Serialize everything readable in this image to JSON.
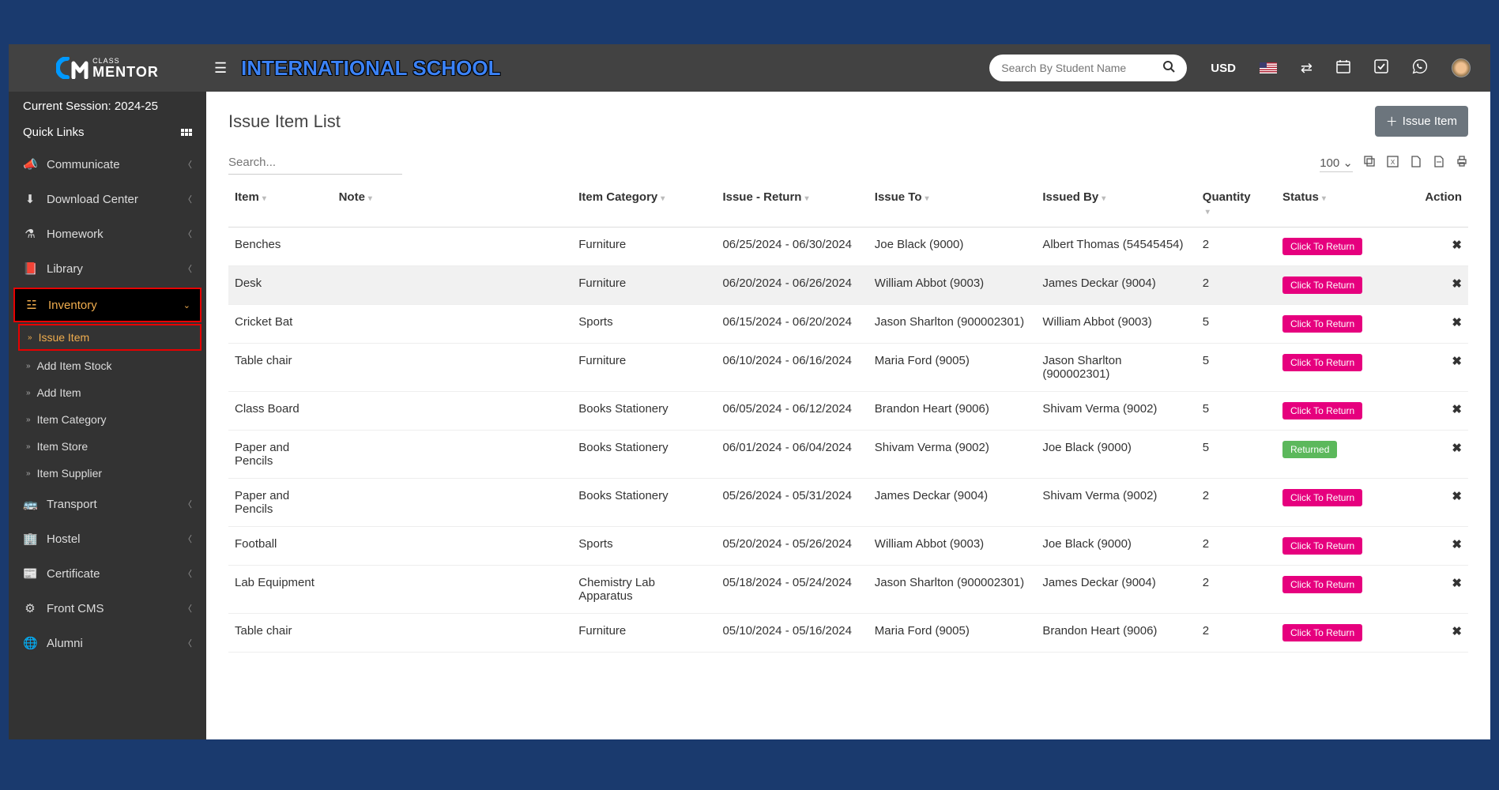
{
  "header": {
    "school_name": "INTERNATIONAL SCHOOL",
    "search_placeholder": "Search By Student Name",
    "currency": "USD"
  },
  "sidebar": {
    "session_label": "Current Session: 2024-25",
    "quick_links": "Quick Links",
    "items": [
      {
        "label": "Communicate"
      },
      {
        "label": "Download Center"
      },
      {
        "label": "Homework"
      },
      {
        "label": "Library"
      },
      {
        "label": "Inventory"
      },
      {
        "label": "Transport"
      },
      {
        "label": "Hostel"
      },
      {
        "label": "Certificate"
      },
      {
        "label": "Front CMS"
      },
      {
        "label": "Alumni"
      }
    ],
    "inventory_sub": [
      {
        "label": "Issue Item"
      },
      {
        "label": "Add Item Stock"
      },
      {
        "label": "Add Item"
      },
      {
        "label": "Item Category"
      },
      {
        "label": "Item Store"
      },
      {
        "label": "Item Supplier"
      }
    ]
  },
  "page": {
    "title": "Issue Item List",
    "add_button": "Issue Item",
    "search_placeholder": "Search...",
    "page_size": "100"
  },
  "table": {
    "headers": {
      "item": "Item",
      "note": "Note",
      "category": "Item Category",
      "issue_return": "Issue - Return",
      "issue_to": "Issue To",
      "issued_by": "Issued By",
      "quantity": "Quantity",
      "status": "Status",
      "action": "Action"
    },
    "status_labels": {
      "click": "Click To Return",
      "returned": "Returned"
    },
    "rows": [
      {
        "item": "Benches",
        "note": "",
        "category": "Furniture",
        "date": "06/25/2024 - 06/30/2024",
        "to": "Joe Black (9000)",
        "by": "Albert Thomas (54545454)",
        "qty": "2",
        "status": "click"
      },
      {
        "item": "Desk",
        "note": "",
        "category": "Furniture",
        "date": "06/20/2024 - 06/26/2024",
        "to": "William Abbot (9003)",
        "by": "James Deckar (9004)",
        "qty": "2",
        "status": "click",
        "hl": true
      },
      {
        "item": "Cricket Bat",
        "note": "",
        "category": "Sports",
        "date": "06/15/2024 - 06/20/2024",
        "to": "Jason Sharlton (900002301)",
        "by": "William Abbot (9003)",
        "qty": "5",
        "status": "click"
      },
      {
        "item": "Table chair",
        "note": "",
        "category": "Furniture",
        "date": "06/10/2024 - 06/16/2024",
        "to": "Maria Ford (9005)",
        "by": "Jason Sharlton (900002301)",
        "qty": "5",
        "status": "click"
      },
      {
        "item": "Class Board",
        "note": "",
        "category": "Books Stationery",
        "date": "06/05/2024 - 06/12/2024",
        "to": "Brandon Heart (9006)",
        "by": "Shivam Verma (9002)",
        "qty": "5",
        "status": "click"
      },
      {
        "item": "Paper and Pencils",
        "note": "",
        "category": "Books Stationery",
        "date": "06/01/2024 - 06/04/2024",
        "to": "Shivam Verma (9002)",
        "by": "Joe Black (9000)",
        "qty": "5",
        "status": "returned"
      },
      {
        "item": "Paper and Pencils",
        "note": "",
        "category": "Books Stationery",
        "date": "05/26/2024 - 05/31/2024",
        "to": "James Deckar (9004)",
        "by": "Shivam Verma (9002)",
        "qty": "2",
        "status": "click"
      },
      {
        "item": "Football",
        "note": "",
        "category": "Sports",
        "date": "05/20/2024 - 05/26/2024",
        "to": "William Abbot (9003)",
        "by": "Joe Black (9000)",
        "qty": "2",
        "status": "click"
      },
      {
        "item": "Lab Equipment",
        "note": "",
        "category": "Chemistry Lab Apparatus",
        "date": "05/18/2024 - 05/24/2024",
        "to": "Jason Sharlton (900002301)",
        "by": "James Deckar (9004)",
        "qty": "2",
        "status": "click"
      },
      {
        "item": "Table chair",
        "note": "",
        "category": "Furniture",
        "date": "05/10/2024 - 05/16/2024",
        "to": "Maria Ford (9005)",
        "by": "Brandon Heart (9006)",
        "qty": "2",
        "status": "click"
      }
    ]
  }
}
